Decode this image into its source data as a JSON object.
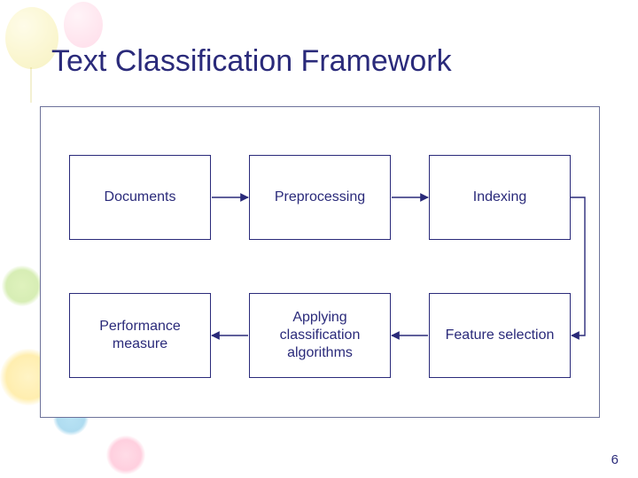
{
  "title": "Text Classification Framework",
  "nodes": {
    "documents": "Documents",
    "preprocessing": "Preprocessing",
    "indexing": "Indexing",
    "performance": "Performance measure",
    "applying": "Applying classification algorithms",
    "feature": "Feature selection"
  },
  "page_number": "6",
  "colors": {
    "text_primary": "#2a2a7a",
    "border": "#6d729a"
  }
}
